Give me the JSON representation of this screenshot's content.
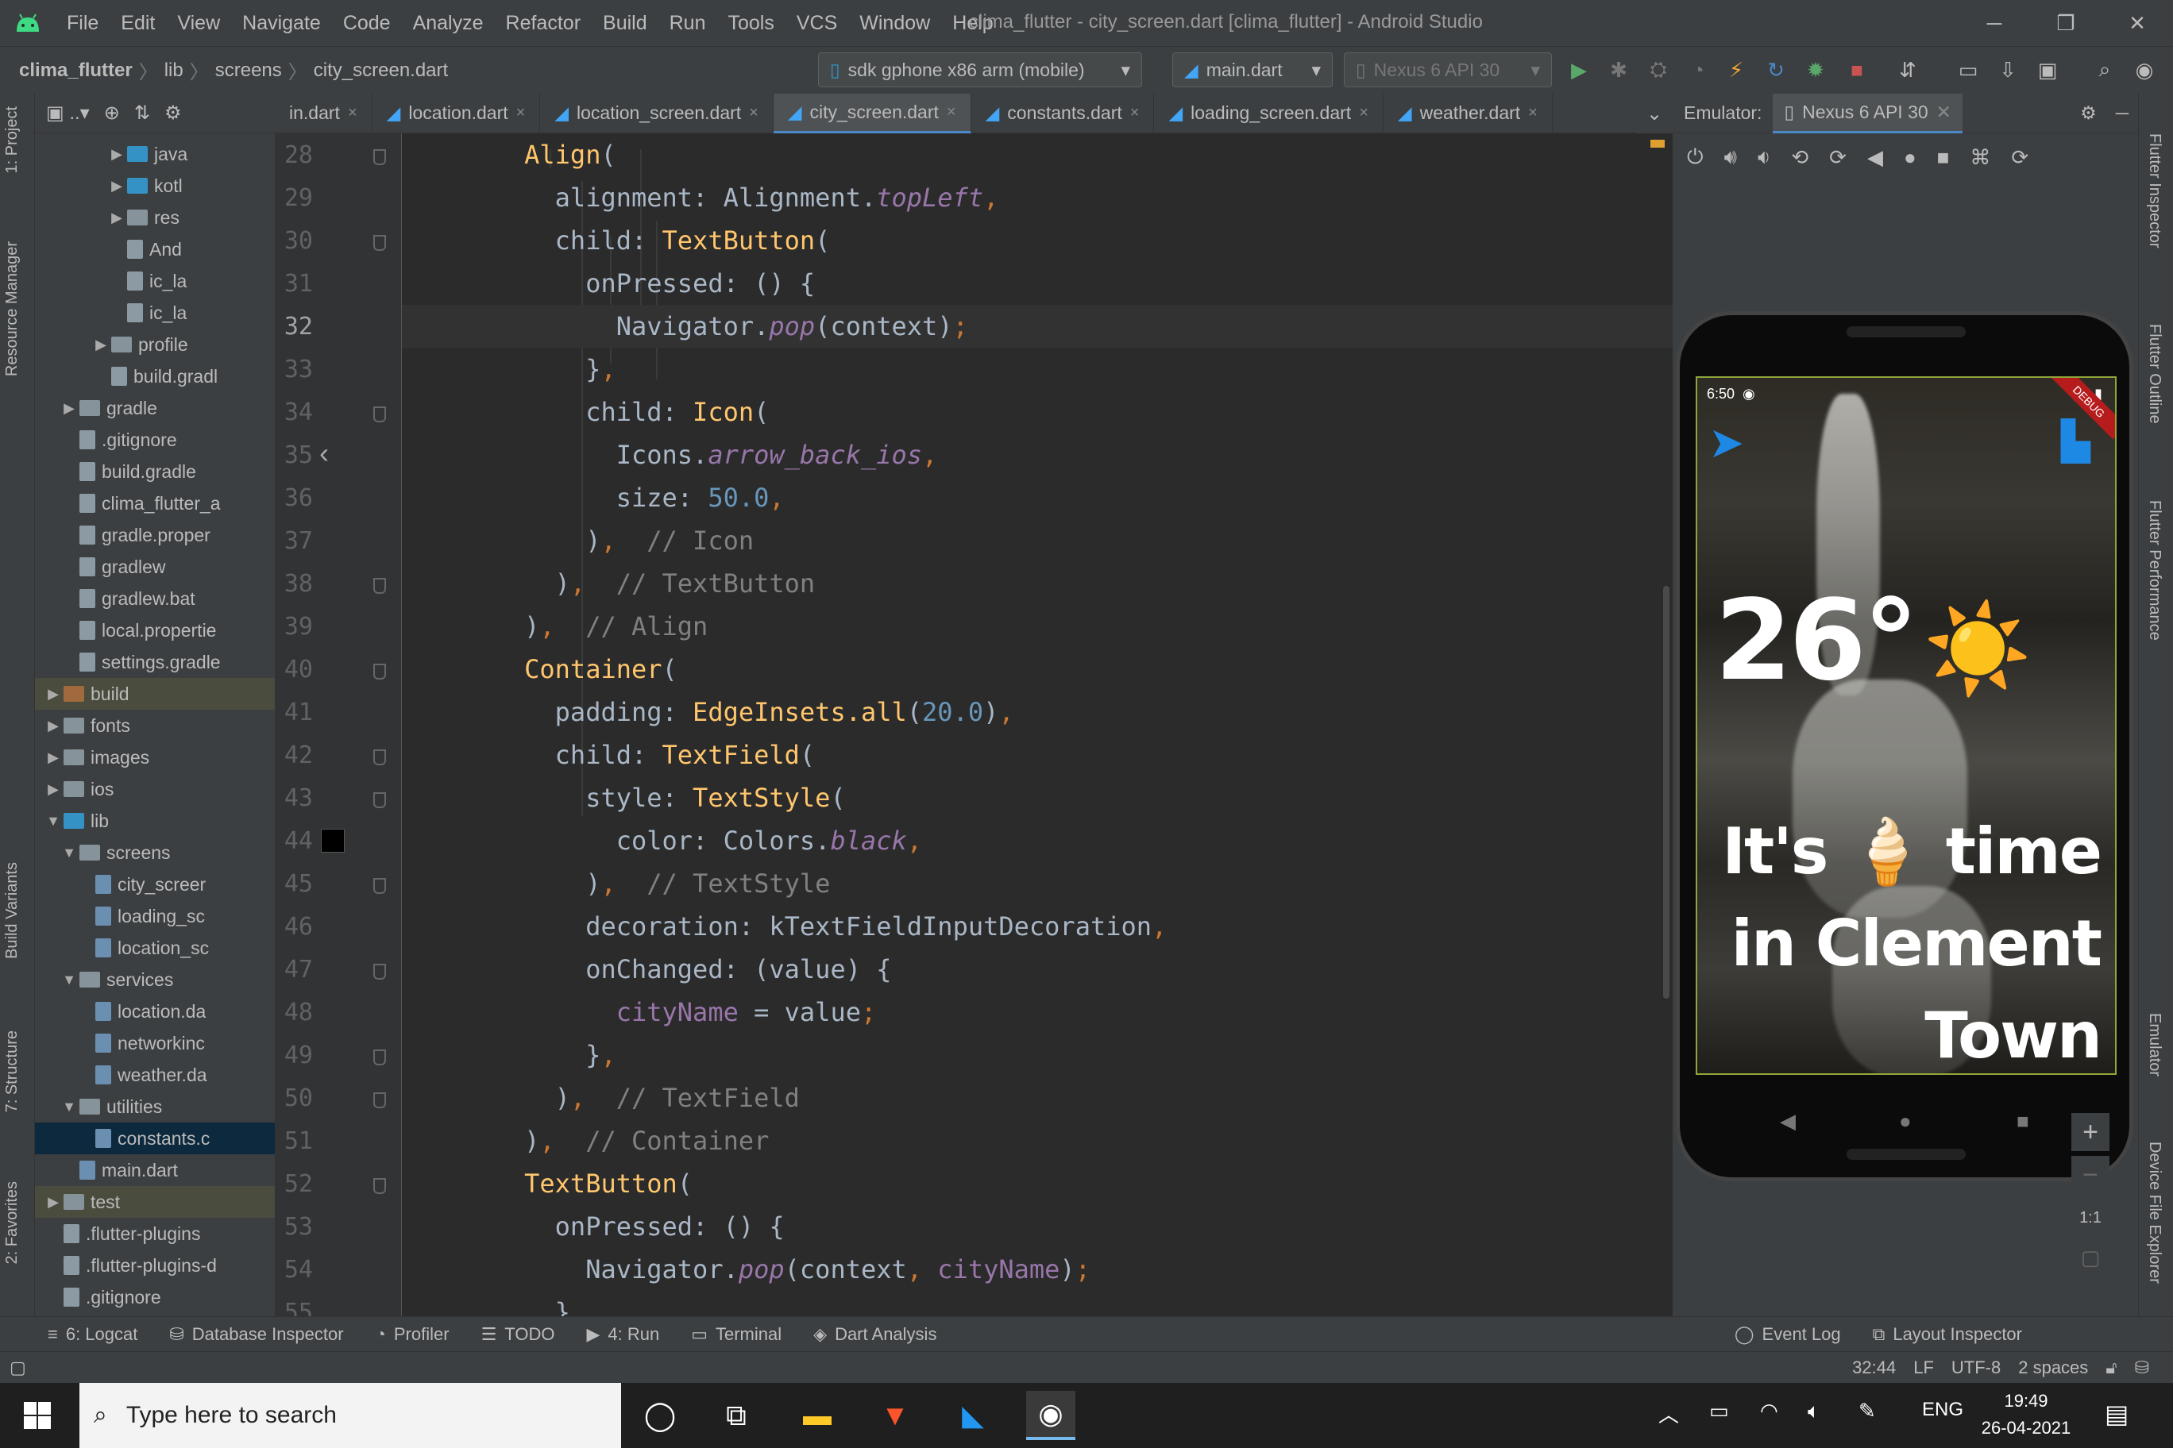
{
  "window": {
    "title": "clima_flutter - city_screen.dart [clima_flutter] - Android Studio",
    "menu": [
      "File",
      "Edit",
      "View",
      "Navigate",
      "Code",
      "Analyze",
      "Refactor",
      "Build",
      "Run",
      "Tools",
      "VCS",
      "Window",
      "Help"
    ]
  },
  "nav": {
    "breadcrumb": [
      "clima_flutter",
      "lib",
      "screens",
      "city_screen.dart"
    ],
    "device_combo": "sdk gphone x86 arm (mobile)",
    "run_config": "main.dart",
    "avd_combo": "Nexus 6 API 30"
  },
  "left_tabs": [
    "1: Project",
    "Resource Manager",
    "Build Variants",
    "7: Structure",
    "2: Favorites"
  ],
  "right_tabs": [
    "Flutter Inspector",
    "Flutter Outline",
    "Flutter Performance",
    "Emulator",
    "Device File Explorer"
  ],
  "project_tree": [
    {
      "label": "java",
      "indent": 5,
      "type": "folder-blue",
      "arrow": "▶"
    },
    {
      "label": "kotl",
      "indent": 5,
      "type": "folder-blue",
      "arrow": "▶"
    },
    {
      "label": "res",
      "indent": 5,
      "type": "folder",
      "arrow": "▶"
    },
    {
      "label": "And",
      "indent": 5,
      "type": "file",
      "arrow": ""
    },
    {
      "label": "ic_la",
      "indent": 5,
      "type": "file",
      "arrow": ""
    },
    {
      "label": "ic_la",
      "indent": 5,
      "type": "file",
      "arrow": ""
    },
    {
      "label": "profile",
      "indent": 4,
      "type": "folder",
      "arrow": "▶"
    },
    {
      "label": "build.gradl",
      "indent": 4,
      "type": "file",
      "arrow": ""
    },
    {
      "label": "gradle",
      "indent": 2,
      "type": "folder",
      "arrow": "▶"
    },
    {
      "label": ".gitignore",
      "indent": 2,
      "type": "file",
      "arrow": ""
    },
    {
      "label": "build.gradle",
      "indent": 2,
      "type": "file",
      "arrow": ""
    },
    {
      "label": "clima_flutter_a",
      "indent": 2,
      "type": "file",
      "arrow": ""
    },
    {
      "label": "gradle.proper",
      "indent": 2,
      "type": "file",
      "arrow": ""
    },
    {
      "label": "gradlew",
      "indent": 2,
      "type": "file",
      "arrow": ""
    },
    {
      "label": "gradlew.bat",
      "indent": 2,
      "type": "file",
      "arrow": ""
    },
    {
      "label": "local.propertie",
      "indent": 2,
      "type": "file",
      "arrow": ""
    },
    {
      "label": "settings.gradle",
      "indent": 2,
      "type": "file",
      "arrow": ""
    },
    {
      "label": "build",
      "indent": 1,
      "type": "folder-orange",
      "arrow": "▶",
      "hl": true
    },
    {
      "label": "fonts",
      "indent": 1,
      "type": "folder",
      "arrow": "▶"
    },
    {
      "label": "images",
      "indent": 1,
      "type": "folder",
      "arrow": "▶"
    },
    {
      "label": "ios",
      "indent": 1,
      "type": "folder",
      "arrow": "▶"
    },
    {
      "label": "lib",
      "indent": 1,
      "type": "folder-blue",
      "arrow": "▼"
    },
    {
      "label": "screens",
      "indent": 2,
      "type": "folder",
      "arrow": "▼"
    },
    {
      "label": "city_screer",
      "indent": 3,
      "type": "dart",
      "arrow": ""
    },
    {
      "label": "loading_sc",
      "indent": 3,
      "type": "dart",
      "arrow": ""
    },
    {
      "label": "location_sc",
      "indent": 3,
      "type": "dart",
      "arrow": ""
    },
    {
      "label": "services",
      "indent": 2,
      "type": "folder",
      "arrow": "▼"
    },
    {
      "label": "location.da",
      "indent": 3,
      "type": "dart",
      "arrow": ""
    },
    {
      "label": "networkinc",
      "indent": 3,
      "type": "dart",
      "arrow": ""
    },
    {
      "label": "weather.da",
      "indent": 3,
      "type": "dart",
      "arrow": ""
    },
    {
      "label": "utilities",
      "indent": 2,
      "type": "folder",
      "arrow": "▼"
    },
    {
      "label": "constants.c",
      "indent": 3,
      "type": "dart",
      "arrow": "",
      "sel": true
    },
    {
      "label": "main.dart",
      "indent": 2,
      "type": "dart",
      "arrow": ""
    },
    {
      "label": "test",
      "indent": 1,
      "type": "folder",
      "arrow": "▶",
      "hl": true
    },
    {
      "label": ".flutter-plugins",
      "indent": 1,
      "type": "file",
      "arrow": ""
    },
    {
      "label": ".flutter-plugins-d",
      "indent": 1,
      "type": "file",
      "arrow": ""
    },
    {
      "label": ".gitignore",
      "indent": 1,
      "type": "file",
      "arrow": ""
    }
  ],
  "editor_tabs": [
    {
      "label": "in.dart",
      "active": false
    },
    {
      "label": "location.dart",
      "active": false
    },
    {
      "label": "location_screen.dart",
      "active": false
    },
    {
      "label": "city_screen.dart",
      "active": true
    },
    {
      "label": "constants.dart",
      "active": false
    },
    {
      "label": "loading_screen.dart",
      "active": false
    },
    {
      "label": "weather.dart",
      "active": false
    }
  ],
  "line_numbers": [
    "28",
    "29",
    "30",
    "31",
    "32",
    "33",
    "34",
    "35",
    "36",
    "37",
    "38",
    "39",
    "40",
    "41",
    "42",
    "43",
    "44",
    "45",
    "46",
    "47",
    "48",
    "49",
    "50",
    "51",
    "52",
    "53",
    "54",
    "55"
  ],
  "code_lines": [
    [
      [
        "        ",
        ""
      ],
      [
        "Align",
        "k"
      ],
      [
        "(",
        ""
      ]
    ],
    [
      [
        "          alignment: Alignment.",
        ""
      ],
      [
        "topLeft",
        "p"
      ],
      [
        ",",
        "o"
      ]
    ],
    [
      [
        "          child: ",
        ""
      ],
      [
        "TextButton",
        "k"
      ],
      [
        "(",
        ""
      ]
    ],
    [
      [
        "            onPressed: () {",
        ""
      ]
    ],
    [
      [
        "              Navigator.",
        ""
      ],
      [
        "pop",
        "p"
      ],
      [
        "(context)",
        ""
      ],
      [
        ";",
        "o"
      ]
    ],
    [
      [
        "            }",
        ""
      ],
      [
        ",",
        "o"
      ]
    ],
    [
      [
        "            child: ",
        ""
      ],
      [
        "Icon",
        "k"
      ],
      [
        "(",
        ""
      ]
    ],
    [
      [
        "              Icons.",
        ""
      ],
      [
        "arrow_back_ios",
        "p"
      ],
      [
        ",",
        "o"
      ]
    ],
    [
      [
        "              size: ",
        ""
      ],
      [
        "50.0",
        "n"
      ],
      [
        ",",
        "o"
      ]
    ],
    [
      [
        "            )",
        ""
      ],
      [
        ",",
        "o"
      ],
      [
        "  // Icon",
        "c"
      ]
    ],
    [
      [
        "          )",
        ""
      ],
      [
        ",",
        "o"
      ],
      [
        "  // TextButton",
        "c"
      ]
    ],
    [
      [
        "        )",
        ""
      ],
      [
        ",",
        "o"
      ],
      [
        "  // Align",
        "c"
      ]
    ],
    [
      [
        "        ",
        ""
      ],
      [
        "Container",
        "k"
      ],
      [
        "(",
        ""
      ]
    ],
    [
      [
        "          padding: ",
        ""
      ],
      [
        "EdgeInsets.all",
        "k"
      ],
      [
        "(",
        ""
      ],
      [
        "20.0",
        "n"
      ],
      [
        ")",
        ""
      ],
      [
        ",",
        "o"
      ]
    ],
    [
      [
        "          child: ",
        ""
      ],
      [
        "TextField",
        "k"
      ],
      [
        "(",
        ""
      ]
    ],
    [
      [
        "            style: ",
        ""
      ],
      [
        "TextStyle",
        "k"
      ],
      [
        "(",
        ""
      ]
    ],
    [
      [
        "              color: Colors.",
        ""
      ],
      [
        "black",
        "p"
      ],
      [
        ",",
        "o"
      ]
    ],
    [
      [
        "            )",
        ""
      ],
      [
        ",",
        "o"
      ],
      [
        "  // TextStyle",
        "c"
      ]
    ],
    [
      [
        "            decoration: kTextFieldInputDecoration",
        ""
      ],
      [
        ",",
        "o"
      ]
    ],
    [
      [
        "            onChanged: (value) {",
        ""
      ]
    ],
    [
      [
        "              ",
        ""
      ],
      [
        "cityName",
        "f"
      ],
      [
        " = value",
        ""
      ],
      [
        ";",
        "o"
      ]
    ],
    [
      [
        "            }",
        ""
      ],
      [
        ",",
        "o"
      ]
    ],
    [
      [
        "          )",
        ""
      ],
      [
        ",",
        "o"
      ],
      [
        "  // TextField",
        "c"
      ]
    ],
    [
      [
        "        )",
        ""
      ],
      [
        ",",
        "o"
      ],
      [
        "  // Container",
        "c"
      ]
    ],
    [
      [
        "        ",
        ""
      ],
      [
        "TextButton",
        "k"
      ],
      [
        "(",
        ""
      ]
    ],
    [
      [
        "          onPressed: () {",
        ""
      ]
    ],
    [
      [
        "            Navigator.",
        ""
      ],
      [
        "pop",
        "p"
      ],
      [
        "(context",
        ""
      ],
      [
        ",",
        "o"
      ],
      [
        " cityName",
        "f"
      ],
      [
        ")",
        ""
      ],
      [
        ";",
        "o"
      ]
    ],
    [
      [
        "          }",
        ""
      ]
    ]
  ],
  "emulator": {
    "label": "Emulator:",
    "device_tab": "Nexus 6 API 30",
    "status_time": "6:50",
    "debug_ribbon": "DEBUG",
    "temperature": "26°",
    "weather_icon": "☀️",
    "message_lines": [
      "It's 🍦 time",
      "in Clement",
      "Town"
    ],
    "zoom_label": "1:1"
  },
  "bottom_tabs": [
    {
      "label": "6: Logcat",
      "icon": "≡"
    },
    {
      "label": "Database Inspector",
      "icon": "⛁"
    },
    {
      "label": "Profiler",
      "icon": "◔"
    },
    {
      "label": "TODO",
      "icon": "☰"
    },
    {
      "label": "4: Run",
      "icon": "▶"
    },
    {
      "label": "Terminal",
      "icon": "▭"
    },
    {
      "label": "Dart Analysis",
      "icon": "◈"
    }
  ],
  "bottom_right_tabs": [
    {
      "label": "Event Log",
      "icon": "◯"
    },
    {
      "label": "Layout Inspector",
      "icon": "⧉"
    }
  ],
  "status": {
    "position": "32:44",
    "line_sep": "LF",
    "encoding": "UTF-8",
    "indent": "2 spaces"
  },
  "taskbar": {
    "search_placeholder": "Type here to search",
    "language": "ENG",
    "time": "19:49",
    "date": "26-04-2021"
  }
}
